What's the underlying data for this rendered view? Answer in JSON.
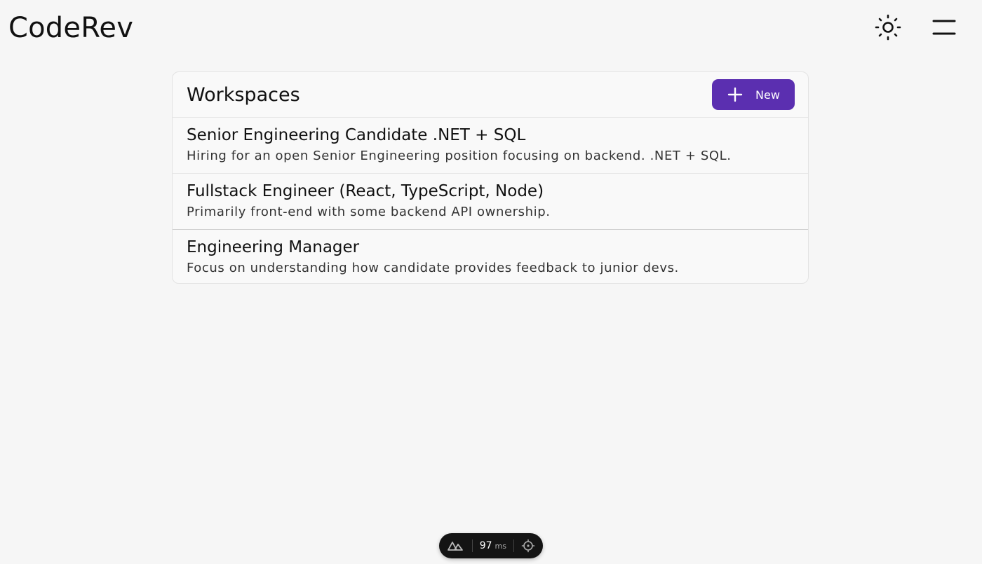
{
  "app": {
    "brand": "CodeRev"
  },
  "header": {
    "theme_icon": "sun-icon",
    "menu_icon": "menu-icon"
  },
  "workspaces": {
    "title": "Workspaces",
    "new_button_label": "New",
    "new_button_icon": "plus-icon",
    "accent_color": "#5b2fb0",
    "items": [
      {
        "title": "Senior Engineering Candidate .NET + SQL",
        "description": "Hiring for an open Senior Engineering position focusing on backend. .NET + SQL."
      },
      {
        "title": "Fullstack Engineer (React, TypeScript, Node)",
        "description": "Primarily front-end with some backend API ownership."
      },
      {
        "title": "Engineering Manager",
        "description": "Focus on understanding how candidate provides feedback to junior devs."
      }
    ]
  },
  "devtools": {
    "logo_icon": "nuxt-logo-icon",
    "render_time": "97",
    "render_unit": "ms",
    "inspect_icon": "crosshair-icon"
  }
}
